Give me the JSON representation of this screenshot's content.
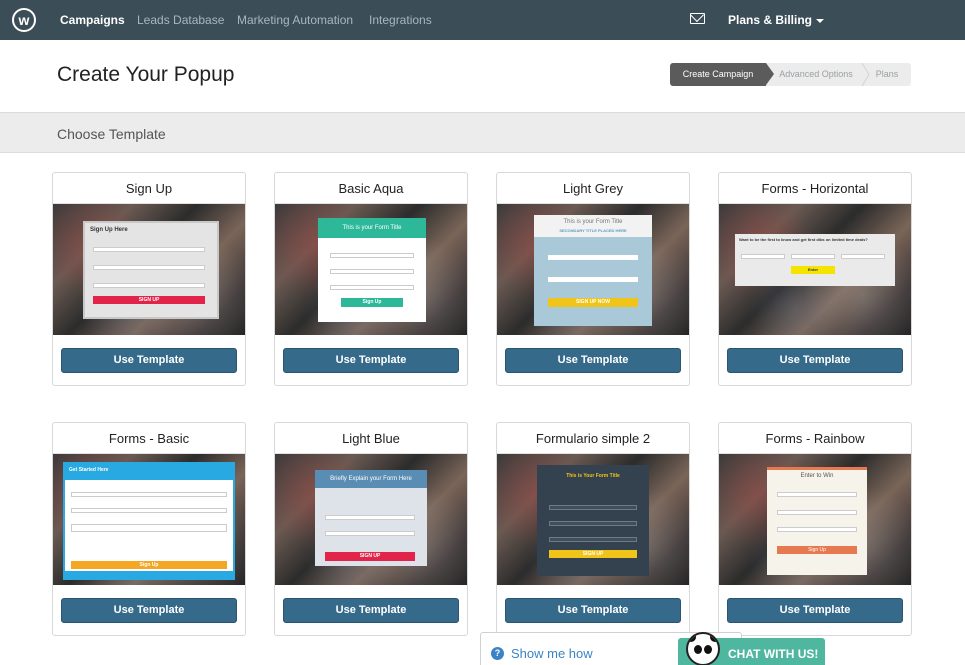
{
  "nav": {
    "logo": "w",
    "items": [
      "Campaigns",
      "Leads Database",
      "Marketing Automation",
      "Integrations"
    ],
    "billing": "Plans & Billing"
  },
  "header": {
    "title": "Create Your Popup",
    "steps": [
      "Create Campaign",
      "Advanced Options",
      "Plans"
    ]
  },
  "section": {
    "title": "Choose Template"
  },
  "templates": [
    {
      "name": "Sign Up",
      "button": "Use Template"
    },
    {
      "name": "Basic Aqua",
      "button": "Use Template"
    },
    {
      "name": "Light Grey",
      "button": "Use Template"
    },
    {
      "name": "Forms - Horizontal",
      "button": "Use Template"
    },
    {
      "name": "Forms - Basic",
      "button": "Use Template"
    },
    {
      "name": "Light Blue",
      "button": "Use Template"
    },
    {
      "name": "Formulario simple 2",
      "button": "Use Template"
    },
    {
      "name": "Forms - Rainbow",
      "button": "Use Template"
    }
  ],
  "previews": {
    "signup": {
      "title": "Sign Up Here",
      "button": "SIGN UP"
    },
    "aqua": {
      "title": "This is your Form Title",
      "button": "Sign Up"
    },
    "grey": {
      "title": "This is your Form Title",
      "subtitle": "SECONDARY TITLE PLACED HERE",
      "button": "SIGN UP NOW"
    },
    "horizontal": {
      "title": "Want to be the first to know and get first dibs on limited time deals?",
      "button": "Enter"
    },
    "basic": {
      "title": "Get Started Here",
      "button": "Sign Up"
    },
    "lightblue": {
      "title": "Briefly Explain your Form Here",
      "button": "SIGN UP"
    },
    "simple2": {
      "title": "This is Your Form Title",
      "button": "SIGN UP"
    },
    "rainbow": {
      "title": "Enter to Win",
      "button": "Sign Up"
    }
  },
  "widgets": {
    "showme": "Show me how",
    "chat": "CHAT WITH US!"
  },
  "colors": {
    "nav_bg": "#3b4d57",
    "button_bg": "#356a8a",
    "chat_bg": "#4fb6a0"
  }
}
